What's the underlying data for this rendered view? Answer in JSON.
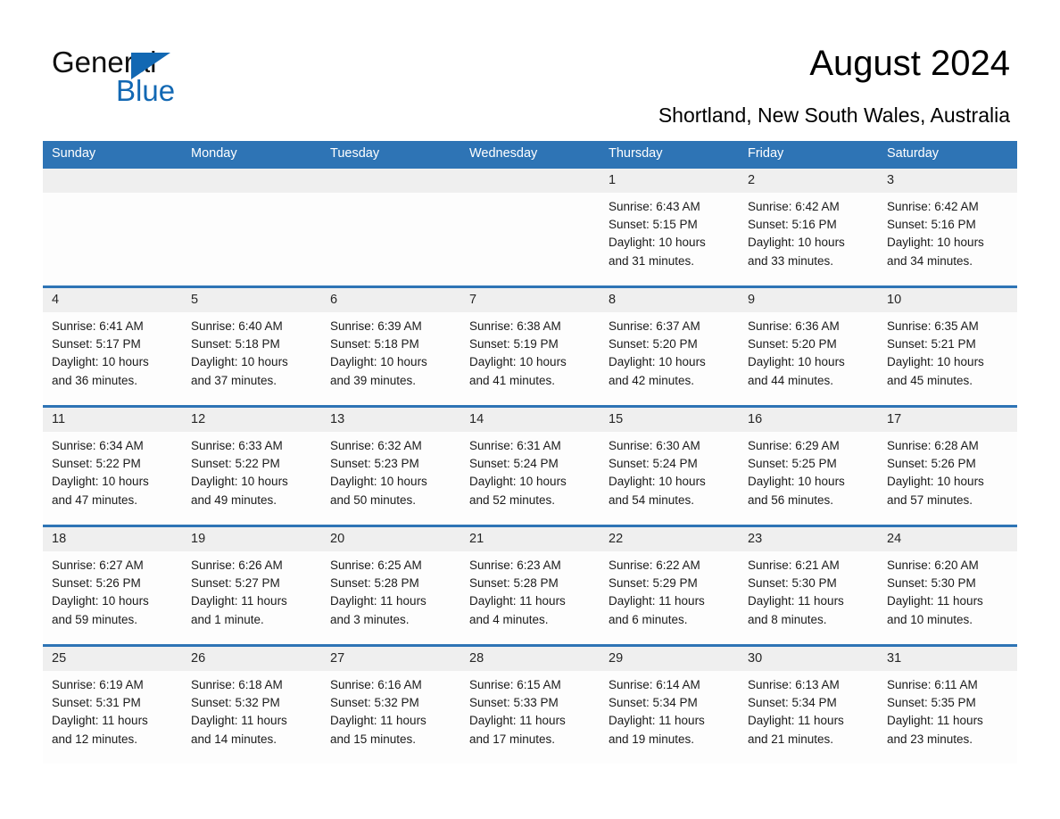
{
  "brand": {
    "name_part1": "General",
    "name_part2": "Blue"
  },
  "header": {
    "title": "August 2024",
    "subtitle": "Shortland, New South Wales, Australia"
  },
  "colors": {
    "header_blue": "#2e74b5",
    "brand_blue": "#1268b3",
    "daystrip_gray": "#efefef",
    "cell_white": "#fdfdfd"
  },
  "calendar": {
    "day_names": [
      "Sunday",
      "Monday",
      "Tuesday",
      "Wednesday",
      "Thursday",
      "Friday",
      "Saturday"
    ],
    "weeks": [
      {
        "days": [
          {
            "num": "",
            "sunrise": "",
            "sunset": "",
            "daylight_1": "",
            "daylight_2": ""
          },
          {
            "num": "",
            "sunrise": "",
            "sunset": "",
            "daylight_1": "",
            "daylight_2": ""
          },
          {
            "num": "",
            "sunrise": "",
            "sunset": "",
            "daylight_1": "",
            "daylight_2": ""
          },
          {
            "num": "",
            "sunrise": "",
            "sunset": "",
            "daylight_1": "",
            "daylight_2": ""
          },
          {
            "num": "1",
            "sunrise": "Sunrise: 6:43 AM",
            "sunset": "Sunset: 5:15 PM",
            "daylight_1": "Daylight: 10 hours",
            "daylight_2": "and 31 minutes."
          },
          {
            "num": "2",
            "sunrise": "Sunrise: 6:42 AM",
            "sunset": "Sunset: 5:16 PM",
            "daylight_1": "Daylight: 10 hours",
            "daylight_2": "and 33 minutes."
          },
          {
            "num": "3",
            "sunrise": "Sunrise: 6:42 AM",
            "sunset": "Sunset: 5:16 PM",
            "daylight_1": "Daylight: 10 hours",
            "daylight_2": "and 34 minutes."
          }
        ]
      },
      {
        "days": [
          {
            "num": "4",
            "sunrise": "Sunrise: 6:41 AM",
            "sunset": "Sunset: 5:17 PM",
            "daylight_1": "Daylight: 10 hours",
            "daylight_2": "and 36 minutes."
          },
          {
            "num": "5",
            "sunrise": "Sunrise: 6:40 AM",
            "sunset": "Sunset: 5:18 PM",
            "daylight_1": "Daylight: 10 hours",
            "daylight_2": "and 37 minutes."
          },
          {
            "num": "6",
            "sunrise": "Sunrise: 6:39 AM",
            "sunset": "Sunset: 5:18 PM",
            "daylight_1": "Daylight: 10 hours",
            "daylight_2": "and 39 minutes."
          },
          {
            "num": "7",
            "sunrise": "Sunrise: 6:38 AM",
            "sunset": "Sunset: 5:19 PM",
            "daylight_1": "Daylight: 10 hours",
            "daylight_2": "and 41 minutes."
          },
          {
            "num": "8",
            "sunrise": "Sunrise: 6:37 AM",
            "sunset": "Sunset: 5:20 PM",
            "daylight_1": "Daylight: 10 hours",
            "daylight_2": "and 42 minutes."
          },
          {
            "num": "9",
            "sunrise": "Sunrise: 6:36 AM",
            "sunset": "Sunset: 5:20 PM",
            "daylight_1": "Daylight: 10 hours",
            "daylight_2": "and 44 minutes."
          },
          {
            "num": "10",
            "sunrise": "Sunrise: 6:35 AM",
            "sunset": "Sunset: 5:21 PM",
            "daylight_1": "Daylight: 10 hours",
            "daylight_2": "and 45 minutes."
          }
        ]
      },
      {
        "days": [
          {
            "num": "11",
            "sunrise": "Sunrise: 6:34 AM",
            "sunset": "Sunset: 5:22 PM",
            "daylight_1": "Daylight: 10 hours",
            "daylight_2": "and 47 minutes."
          },
          {
            "num": "12",
            "sunrise": "Sunrise: 6:33 AM",
            "sunset": "Sunset: 5:22 PM",
            "daylight_1": "Daylight: 10 hours",
            "daylight_2": "and 49 minutes."
          },
          {
            "num": "13",
            "sunrise": "Sunrise: 6:32 AM",
            "sunset": "Sunset: 5:23 PM",
            "daylight_1": "Daylight: 10 hours",
            "daylight_2": "and 50 minutes."
          },
          {
            "num": "14",
            "sunrise": "Sunrise: 6:31 AM",
            "sunset": "Sunset: 5:24 PM",
            "daylight_1": "Daylight: 10 hours",
            "daylight_2": "and 52 minutes."
          },
          {
            "num": "15",
            "sunrise": "Sunrise: 6:30 AM",
            "sunset": "Sunset: 5:24 PM",
            "daylight_1": "Daylight: 10 hours",
            "daylight_2": "and 54 minutes."
          },
          {
            "num": "16",
            "sunrise": "Sunrise: 6:29 AM",
            "sunset": "Sunset: 5:25 PM",
            "daylight_1": "Daylight: 10 hours",
            "daylight_2": "and 56 minutes."
          },
          {
            "num": "17",
            "sunrise": "Sunrise: 6:28 AM",
            "sunset": "Sunset: 5:26 PM",
            "daylight_1": "Daylight: 10 hours",
            "daylight_2": "and 57 minutes."
          }
        ]
      },
      {
        "days": [
          {
            "num": "18",
            "sunrise": "Sunrise: 6:27 AM",
            "sunset": "Sunset: 5:26 PM",
            "daylight_1": "Daylight: 10 hours",
            "daylight_2": "and 59 minutes."
          },
          {
            "num": "19",
            "sunrise": "Sunrise: 6:26 AM",
            "sunset": "Sunset: 5:27 PM",
            "daylight_1": "Daylight: 11 hours",
            "daylight_2": "and 1 minute."
          },
          {
            "num": "20",
            "sunrise": "Sunrise: 6:25 AM",
            "sunset": "Sunset: 5:28 PM",
            "daylight_1": "Daylight: 11 hours",
            "daylight_2": "and 3 minutes."
          },
          {
            "num": "21",
            "sunrise": "Sunrise: 6:23 AM",
            "sunset": "Sunset: 5:28 PM",
            "daylight_1": "Daylight: 11 hours",
            "daylight_2": "and 4 minutes."
          },
          {
            "num": "22",
            "sunrise": "Sunrise: 6:22 AM",
            "sunset": "Sunset: 5:29 PM",
            "daylight_1": "Daylight: 11 hours",
            "daylight_2": "and 6 minutes."
          },
          {
            "num": "23",
            "sunrise": "Sunrise: 6:21 AM",
            "sunset": "Sunset: 5:30 PM",
            "daylight_1": "Daylight: 11 hours",
            "daylight_2": "and 8 minutes."
          },
          {
            "num": "24",
            "sunrise": "Sunrise: 6:20 AM",
            "sunset": "Sunset: 5:30 PM",
            "daylight_1": "Daylight: 11 hours",
            "daylight_2": "and 10 minutes."
          }
        ]
      },
      {
        "days": [
          {
            "num": "25",
            "sunrise": "Sunrise: 6:19 AM",
            "sunset": "Sunset: 5:31 PM",
            "daylight_1": "Daylight: 11 hours",
            "daylight_2": "and 12 minutes."
          },
          {
            "num": "26",
            "sunrise": "Sunrise: 6:18 AM",
            "sunset": "Sunset: 5:32 PM",
            "daylight_1": "Daylight: 11 hours",
            "daylight_2": "and 14 minutes."
          },
          {
            "num": "27",
            "sunrise": "Sunrise: 6:16 AM",
            "sunset": "Sunset: 5:32 PM",
            "daylight_1": "Daylight: 11 hours",
            "daylight_2": "and 15 minutes."
          },
          {
            "num": "28",
            "sunrise": "Sunrise: 6:15 AM",
            "sunset": "Sunset: 5:33 PM",
            "daylight_1": "Daylight: 11 hours",
            "daylight_2": "and 17 minutes."
          },
          {
            "num": "29",
            "sunrise": "Sunrise: 6:14 AM",
            "sunset": "Sunset: 5:34 PM",
            "daylight_1": "Daylight: 11 hours",
            "daylight_2": "and 19 minutes."
          },
          {
            "num": "30",
            "sunrise": "Sunrise: 6:13 AM",
            "sunset": "Sunset: 5:34 PM",
            "daylight_1": "Daylight: 11 hours",
            "daylight_2": "and 21 minutes."
          },
          {
            "num": "31",
            "sunrise": "Sunrise: 6:11 AM",
            "sunset": "Sunset: 5:35 PM",
            "daylight_1": "Daylight: 11 hours",
            "daylight_2": "and 23 minutes."
          }
        ]
      }
    ]
  }
}
